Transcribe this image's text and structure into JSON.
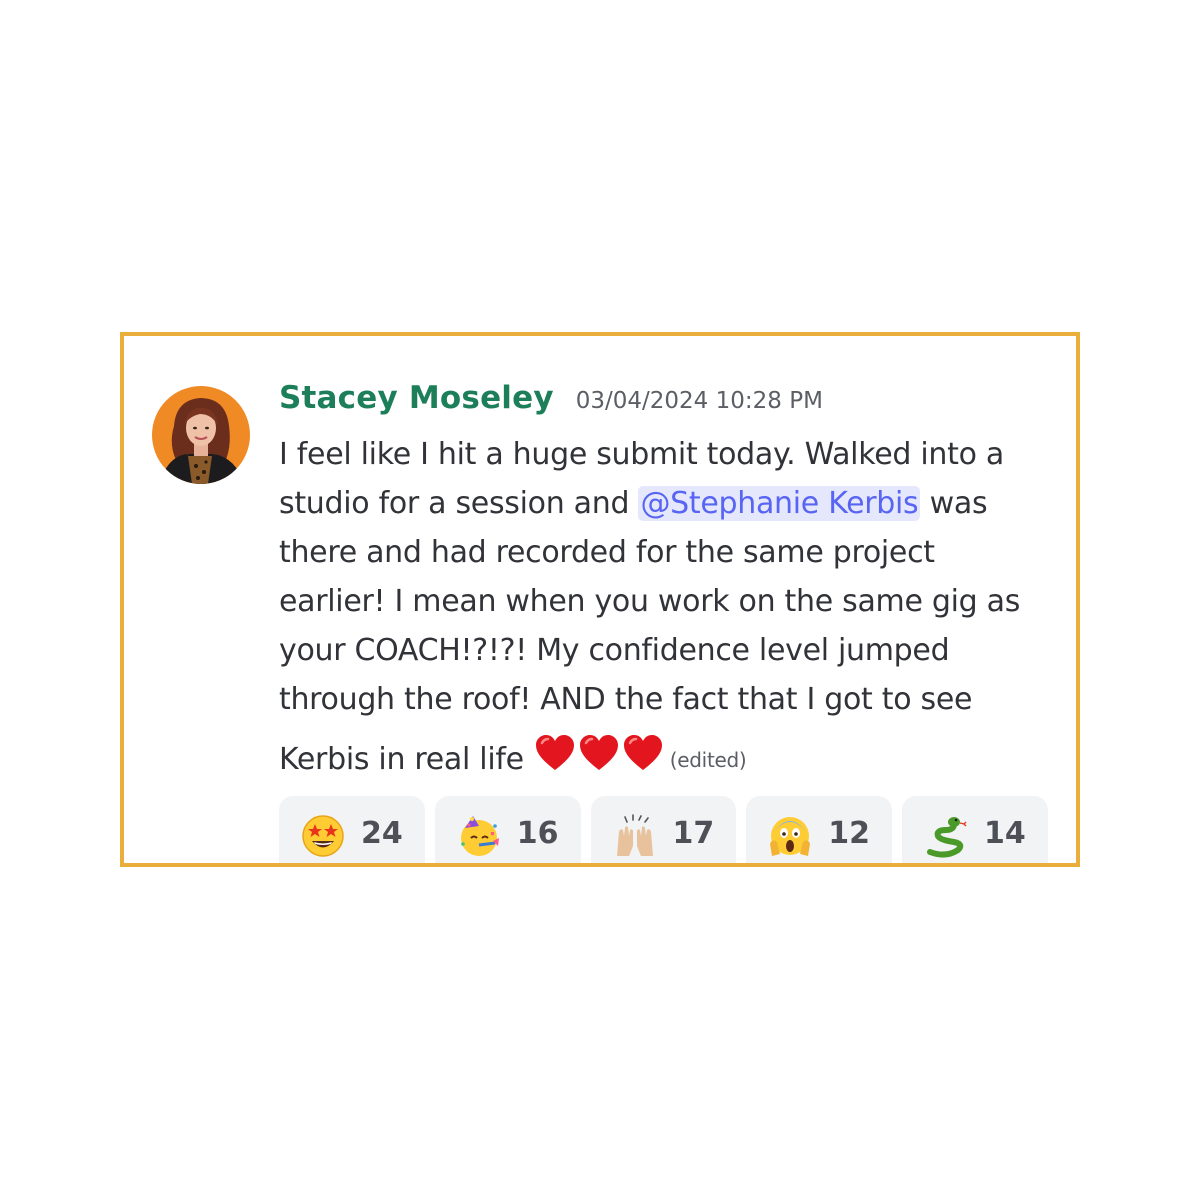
{
  "message": {
    "author": "Stacey Moseley",
    "timestamp": "03/04/2024 10:28 PM",
    "line1": "I feel like I hit a huge submit today. Walked into a",
    "line2_before": "studio for a session and ",
    "mention": "@Stephanie Kerbis",
    "line2_after": " was",
    "line3": "there and had recorded for the same project",
    "line4": "earlier! I mean when you work on the same gig as",
    "line5": "your COACH!?!?! My confidence level jumped",
    "line6": "through the roof! AND the fact that I got to see",
    "line7": "Kerbis in real life",
    "edited": "(edited)",
    "trailing_emoji": [
      "red-heart-icon",
      "red-heart-icon",
      "red-heart-icon"
    ]
  },
  "reactions": [
    {
      "emoji": "star-struck-icon",
      "count": "24"
    },
    {
      "emoji": "partying-face-icon",
      "count": "16"
    },
    {
      "emoji": "raising-hands-icon",
      "count": "17"
    },
    {
      "emoji": "screaming-face-icon",
      "count": "12"
    },
    {
      "emoji": "snake-icon",
      "count": "14"
    }
  ],
  "colors": {
    "card_border": "#e9ae3c",
    "author": "#1d7f5a",
    "mention_text": "#5865f2",
    "mention_bg": "#e5e7fd",
    "reaction_bg": "#f2f3f5",
    "avatar_bg": "#f08a24"
  }
}
